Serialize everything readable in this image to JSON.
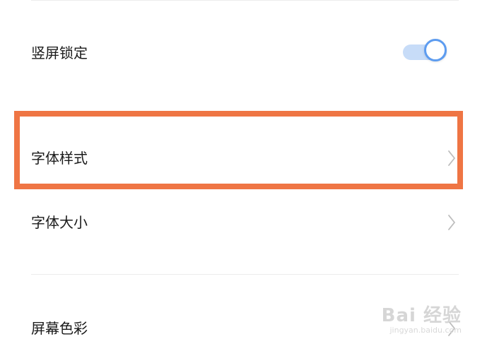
{
  "settings": {
    "items": [
      {
        "label": "竖屏锁定",
        "control": "toggle",
        "toggle_on": true
      },
      {
        "label": "字体样式",
        "control": "chevron",
        "highlighted": true
      },
      {
        "label": "字体大小",
        "control": "chevron"
      },
      {
        "label": "屏幕色彩",
        "control": "chevron"
      }
    ]
  },
  "highlight": {
    "color": "#ef7544"
  },
  "toggle_colors": {
    "track": "#c7dcf8",
    "knob_border": "#5d9cf0"
  },
  "watermark": {
    "main": "Bai 经验",
    "sub": "jingyan.baidu.com"
  }
}
